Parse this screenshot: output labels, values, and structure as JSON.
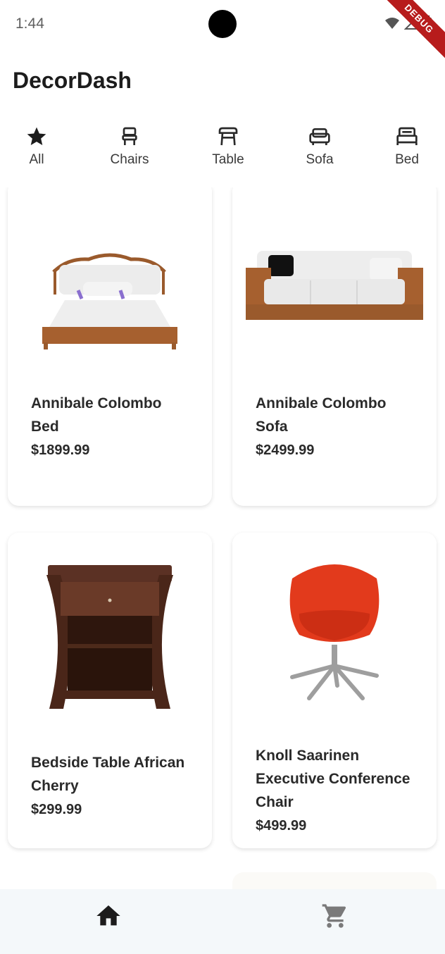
{
  "status_bar": {
    "time": "1:44",
    "debug_label": "DEBUG"
  },
  "app": {
    "title": "DecorDash"
  },
  "categories": [
    {
      "label": "All",
      "icon": "star-icon"
    },
    {
      "label": "Chairs",
      "icon": "chair-icon"
    },
    {
      "label": "Table",
      "icon": "table-icon"
    },
    {
      "label": "Sofa",
      "icon": "sofa-icon"
    },
    {
      "label": "Bed",
      "icon": "bed-icon"
    }
  ],
  "products": [
    {
      "name": "Annibale Colombo Bed",
      "price": "$1899.99",
      "image": "bed-image"
    },
    {
      "name": "Annibale Colombo Sofa",
      "price": "$2499.99",
      "image": "sofa-image"
    },
    {
      "name": "Bedside Table African Cherry",
      "price": "$299.99",
      "image": "bedside-table-image"
    },
    {
      "name": "Knoll Saarinen Executive Conference Chair",
      "price": "$499.99",
      "image": "office-chair-image"
    }
  ],
  "bottom_nav": [
    {
      "icon": "home-icon",
      "active": true
    },
    {
      "icon": "cart-icon",
      "active": false
    }
  ],
  "colors": {
    "background": "#ffffff",
    "nav_background": "#f4f8fa",
    "active_icon": "#1c1c1c",
    "inactive_icon": "#7a7a7a",
    "chair_red": "#e23a1c",
    "wood": "#9a5a2c"
  }
}
